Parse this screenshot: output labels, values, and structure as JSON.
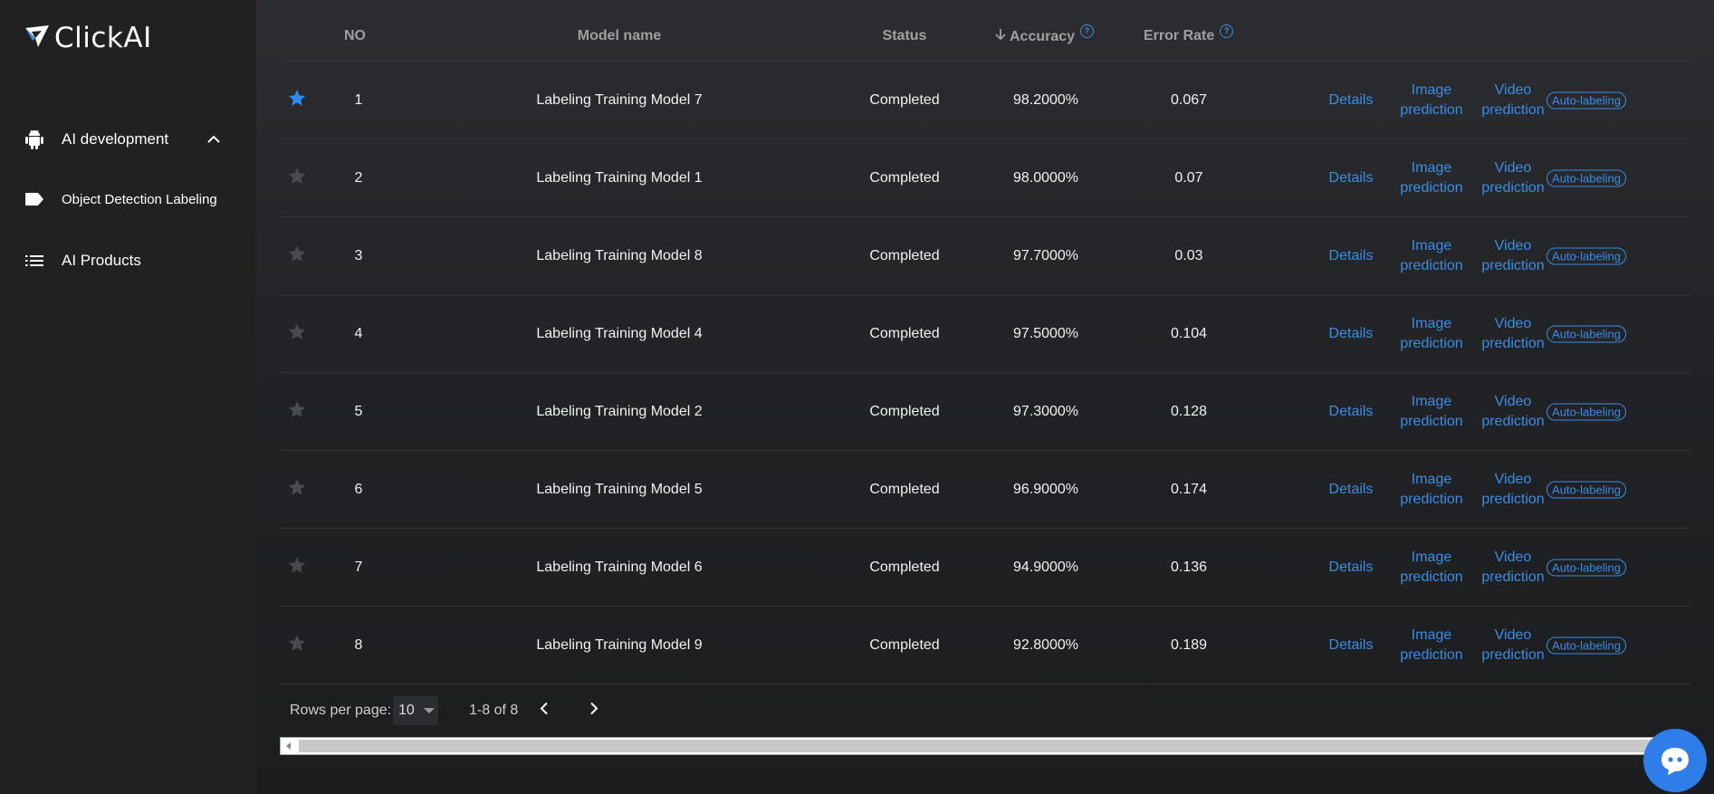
{
  "brand": {
    "name": "ClickAI"
  },
  "sidebar": {
    "items": [
      {
        "label": "AI development",
        "icon": "android-icon",
        "expanded": true
      },
      {
        "label": "Object Detection Labeling",
        "icon": "label-tag-icon"
      },
      {
        "label": "AI Products",
        "icon": "list-icon"
      }
    ]
  },
  "table": {
    "headers": {
      "no": "NO",
      "model_name": "Model name",
      "status": "Status",
      "accuracy": "Accuracy",
      "error_rate": "Error Rate"
    },
    "sort": {
      "column": "accuracy",
      "direction": "descending"
    },
    "action_labels": {
      "details": "Details",
      "image_line1": "Image",
      "image_line2": "prediction",
      "video_line1": "Video",
      "video_line2": "prediction",
      "auto": "Auto-labeling"
    },
    "rows": [
      {
        "starred": true,
        "no": "1",
        "name": "Labeling Training Model 7",
        "status": "Completed",
        "accuracy": "98.2000%",
        "error_rate": "0.067"
      },
      {
        "starred": false,
        "no": "2",
        "name": "Labeling Training Model 1",
        "status": "Completed",
        "accuracy": "98.0000%",
        "error_rate": "0.07"
      },
      {
        "starred": false,
        "no": "3",
        "name": "Labeling Training Model 8",
        "status": "Completed",
        "accuracy": "97.7000%",
        "error_rate": "0.03"
      },
      {
        "starred": false,
        "no": "4",
        "name": "Labeling Training Model 4",
        "status": "Completed",
        "accuracy": "97.5000%",
        "error_rate": "0.104"
      },
      {
        "starred": false,
        "no": "5",
        "name": "Labeling Training Model 2",
        "status": "Completed",
        "accuracy": "97.3000%",
        "error_rate": "0.128"
      },
      {
        "starred": false,
        "no": "6",
        "name": "Labeling Training Model 5",
        "status": "Completed",
        "accuracy": "96.9000%",
        "error_rate": "0.174"
      },
      {
        "starred": false,
        "no": "7",
        "name": "Labeling Training Model 6",
        "status": "Completed",
        "accuracy": "94.9000%",
        "error_rate": "0.136"
      },
      {
        "starred": false,
        "no": "8",
        "name": "Labeling Training Model 9",
        "status": "Completed",
        "accuracy": "92.8000%",
        "error_rate": "0.189"
      }
    ]
  },
  "pagination": {
    "rows_per_page_label": "Rows per page:",
    "rows_per_page": "10",
    "range": "1-8 of 8"
  },
  "colors": {
    "accent": "#3a8ee6",
    "star_active": "#2f8cf0",
    "star_inactive": "#4a4b4e",
    "sidebar_bg": "#212121",
    "chat_fab": "#2f7de8"
  }
}
